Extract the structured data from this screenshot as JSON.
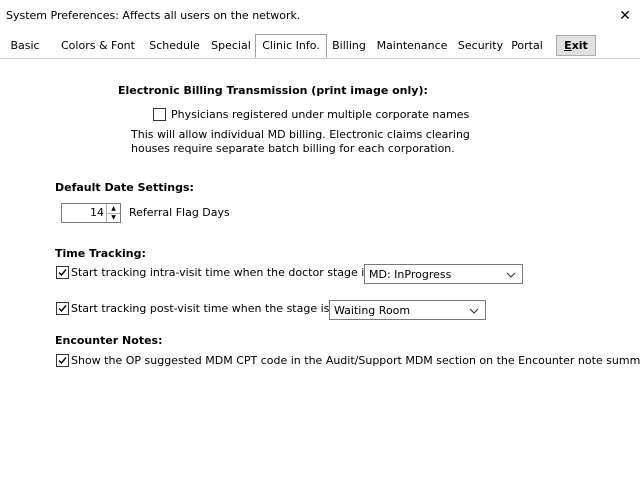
{
  "window": {
    "title": "System Preferences: Affects all users on the network.",
    "close_glyph": "✕"
  },
  "tabs": [
    {
      "label": "Basic"
    },
    {
      "label": "Colors & Font"
    },
    {
      "label": "Schedule"
    },
    {
      "label": "Special"
    },
    {
      "label": "Clinic Info."
    },
    {
      "label": "Billing"
    },
    {
      "label": "Maintenance"
    },
    {
      "label": "Security"
    },
    {
      "label": "Portal"
    }
  ],
  "active_tab": "Clinic Info.",
  "exit_button": {
    "underlined_char": "E",
    "rest": "xit"
  },
  "billing": {
    "heading": "Electronic Billing Transmission (print image only):",
    "checkbox_label": "Physicians registered under multiple corporate names",
    "checked": false,
    "description_line1": "This will allow individual MD billing. Electronic claims clearing",
    "description_line2": "houses require separate batch billing for each corporation."
  },
  "date_settings": {
    "heading": "Default Date Settings:",
    "referral_flag_days_value": "14",
    "referral_flag_days_label": "Referral Flag Days"
  },
  "time_tracking": {
    "heading": "Time Tracking:",
    "intra_visit_label": "Start tracking intra-visit time when the doctor stage is",
    "intra_visit_checked": true,
    "intra_visit_stage": "MD: InProgress",
    "post_visit_label": "Start tracking post-visit time when the stage is",
    "post_visit_checked": true,
    "post_visit_stage": "Waiting Room"
  },
  "encounter_notes": {
    "heading": "Encounter Notes:",
    "mdm_label": "Show the OP suggested MDM CPT code in the Audit/Support MDM section on the Encounter note summary",
    "mdm_checked": true
  }
}
